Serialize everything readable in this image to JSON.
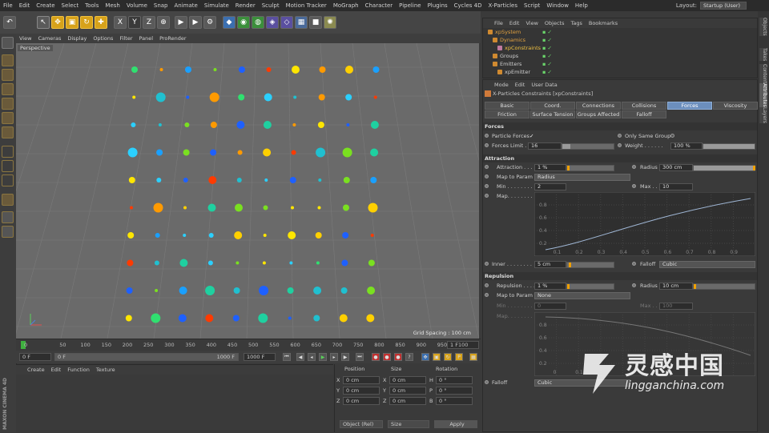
{
  "menubar": [
    "File",
    "Edit",
    "Create",
    "Select",
    "Tools",
    "Mesh",
    "Volume",
    "Snap",
    "Animate",
    "Simulate",
    "Render",
    "Sculpt",
    "Motion Tracker",
    "MoGraph",
    "Character",
    "Pipeline",
    "Plugins",
    "Cycles 4D",
    "X-Particles",
    "Script",
    "Window",
    "Help"
  ],
  "layout": {
    "label": "Layout:",
    "value": "Startup (User)"
  },
  "viewport": {
    "menu": [
      "View",
      "Cameras",
      "Display",
      "Options",
      "Filter",
      "Panel",
      "ProRender"
    ],
    "camera_label": "Perspective",
    "grid_spacing": "Grid Spacing : 100 cm"
  },
  "timeline": {
    "ticks": [
      "0",
      "50",
      "100",
      "150",
      "200",
      "250",
      "300",
      "350",
      "400",
      "450",
      "500",
      "550",
      "600",
      "650",
      "700",
      "750",
      "800",
      "850",
      "900",
      "950",
      "100"
    ],
    "current_frame": "1 F",
    "start": "0 F",
    "min": "0 F",
    "max": "1000 F",
    "end": "1000 F"
  },
  "material": {
    "menu": [
      "Create",
      "Edit",
      "Function",
      "Texture"
    ]
  },
  "coords": {
    "headers": [
      "Position",
      "Size",
      "Rotation"
    ],
    "rows": [
      {
        "axis": "X",
        "pos": "0 cm",
        "saxis": "X",
        "size": "0 cm",
        "raxis": "H",
        "rot": "0 °"
      },
      {
        "axis": "Y",
        "pos": "0 cm",
        "saxis": "Y",
        "size": "0 cm",
        "raxis": "P",
        "rot": "0 °"
      },
      {
        "axis": "Z",
        "pos": "0 cm",
        "saxis": "Z",
        "size": "0 cm",
        "raxis": "B",
        "rot": "0 °"
      }
    ],
    "mode": "Object (Rel)",
    "size_mode": "Size",
    "apply": "Apply"
  },
  "brand": "MAXON CINEMA 4D",
  "object_manager": {
    "menu": [
      "File",
      "Edit",
      "View",
      "Objects",
      "Tags",
      "Bookmarks"
    ],
    "items": [
      {
        "name": "xpSystem",
        "color": "#e0a040"
      },
      {
        "name": "Dynamics",
        "color": "#e0a040"
      },
      {
        "name": "xpConstraints",
        "color": "#f0c040"
      },
      {
        "name": "Groups",
        "color": "#cfcfcf"
      },
      {
        "name": "Emitters",
        "color": "#cfcfcf"
      },
      {
        "name": "xpEmitter",
        "color": "#cfcfcf"
      }
    ]
  },
  "attributes": {
    "menu": [
      "Mode",
      "Edit",
      "User Data"
    ],
    "object_title": "X-Particles Constraints [xpConstraints]",
    "tabs_row1": [
      "Basic",
      "Coord.",
      "Connections",
      "Collisions",
      "Forces",
      "Viscosity"
    ],
    "tabs_row2": [
      "Friction",
      "Surface Tension",
      "Groups Affected",
      "Falloff"
    ],
    "active_tab": "Forces",
    "forces": {
      "section": "Forces",
      "particle_forces": "Particle Forces",
      "particle_forces_check": "✓",
      "only_same_group": "Only Same Group",
      "forces_limit_label": "Forces Limit . .",
      "forces_limit": "16",
      "weight_label": "Weight . . . . . .",
      "weight": "100 %",
      "forces_limit_level": 0.16,
      "weight_level": 1.0
    },
    "attraction": {
      "section": "Attraction",
      "attraction_label": "Attraction . . . .",
      "attraction": "1 %",
      "radius_label": "Radius",
      "radius": "300 cm",
      "map_label": "Map to Param",
      "map_value": "Radius",
      "min_label": "Min . . . . . . . . .",
      "min": "2",
      "max_label": "Max . .",
      "max": "10",
      "curve_label": "Map. . . . . . . . .",
      "curve_ticks_x": [
        "0.1",
        "0.2",
        "0.3",
        "0.4",
        "0.5",
        "0.6",
        "0.7",
        "0.8",
        "0.9"
      ],
      "curve_ticks_y": [
        "0.8",
        "0.6",
        "0.4",
        "0.2"
      ],
      "inner_label": "Inner . . . . . . . .",
      "inner": "5 cm",
      "falloff_label": "Falloff",
      "falloff": "Cubic"
    },
    "repulsion": {
      "section": "Repulsion",
      "repulsion_label": "Repulsion . . . .",
      "repulsion": "1 %",
      "radius_label": "Radius",
      "radius": "10 cm",
      "map_label": "Map to Param",
      "map_value": "None",
      "min_label": "Min . . . . . . . . .",
      "min": "0",
      "max_label": "Max . .",
      "max": "100",
      "curve_label": "Map. . . . . . . . .",
      "curve_ticks_y": [
        "0.8",
        "0.6",
        "0.4",
        "0.2"
      ],
      "curve_ticks_x": [
        "0",
        "0.1"
      ],
      "falloff_label": "Falloff",
      "falloff": "Cubic"
    }
  },
  "right_tabs": [
    "Objects",
    "Takes",
    "Content Browser",
    "Attributes",
    "Layers"
  ],
  "watermark": {
    "cn": "灵感中国",
    "url": "lingganchina.com"
  }
}
